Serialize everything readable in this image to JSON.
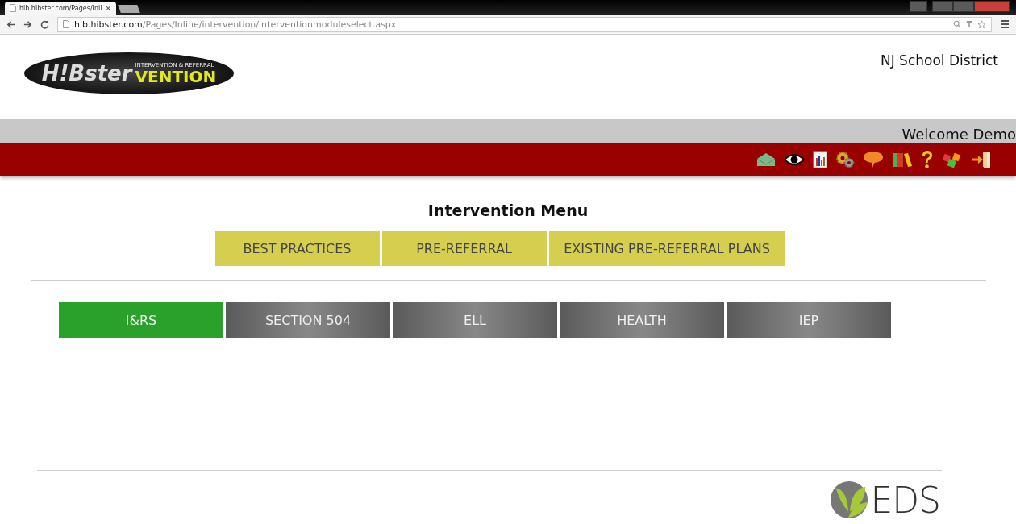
{
  "browser": {
    "tab_title": "hib.hibster.com/Pages/Inli",
    "tab_close": "×",
    "url_host": "hib.hibster.com",
    "url_path": "/Pages/Inline/intervention/interventionmoduleselect.aspx"
  },
  "header": {
    "logo": {
      "brand": "H!Bster",
      "tagline": "INTERVENTION & REFERRAL",
      "word": "VENTION"
    },
    "district": "NJ School District"
  },
  "welcome": "Welcome Demo",
  "toolbar_icons": [
    {
      "kind": "mail"
    },
    {
      "kind": "eye"
    },
    {
      "kind": "chart"
    },
    {
      "kind": "gears"
    },
    {
      "kind": "speech"
    },
    {
      "kind": "books"
    },
    {
      "kind": "help"
    },
    {
      "kind": "cubes"
    },
    {
      "kind": "exit"
    }
  ],
  "menu": {
    "title": "Intervention Menu",
    "buttons": [
      "BEST PRACTICES",
      "PRE-REFERRAL",
      "EXISTING PRE-REFERRAL PLANS"
    ]
  },
  "modules": [
    {
      "label": "I&RS",
      "selected": true
    },
    {
      "label": "SECTION 504",
      "selected": false
    },
    {
      "label": "ELL",
      "selected": false
    },
    {
      "label": "HEALTH",
      "selected": false
    },
    {
      "label": "IEP",
      "selected": false
    }
  ],
  "footer": {
    "logo_text": "EDS"
  }
}
